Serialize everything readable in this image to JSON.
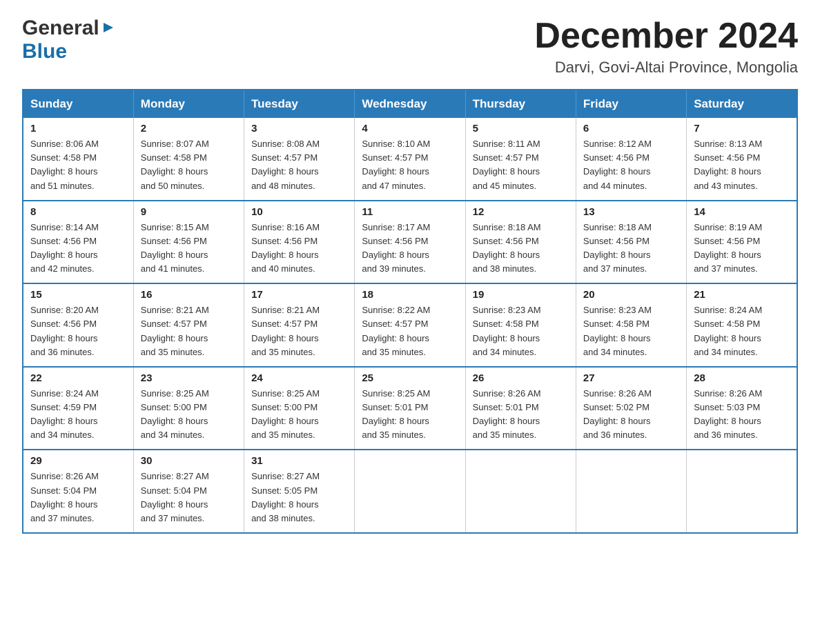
{
  "header": {
    "logo_general": "General",
    "logo_blue": "Blue",
    "month_title": "December 2024",
    "location": "Darvi, Govi-Altai Province, Mongolia"
  },
  "days_of_week": [
    "Sunday",
    "Monday",
    "Tuesday",
    "Wednesday",
    "Thursday",
    "Friday",
    "Saturday"
  ],
  "weeks": [
    [
      {
        "day": "1",
        "sunrise": "8:06 AM",
        "sunset": "4:58 PM",
        "daylight": "8 hours and 51 minutes."
      },
      {
        "day": "2",
        "sunrise": "8:07 AM",
        "sunset": "4:58 PM",
        "daylight": "8 hours and 50 minutes."
      },
      {
        "day": "3",
        "sunrise": "8:08 AM",
        "sunset": "4:57 PM",
        "daylight": "8 hours and 48 minutes."
      },
      {
        "day": "4",
        "sunrise": "8:10 AM",
        "sunset": "4:57 PM",
        "daylight": "8 hours and 47 minutes."
      },
      {
        "day": "5",
        "sunrise": "8:11 AM",
        "sunset": "4:57 PM",
        "daylight": "8 hours and 45 minutes."
      },
      {
        "day": "6",
        "sunrise": "8:12 AM",
        "sunset": "4:56 PM",
        "daylight": "8 hours and 44 minutes."
      },
      {
        "day": "7",
        "sunrise": "8:13 AM",
        "sunset": "4:56 PM",
        "daylight": "8 hours and 43 minutes."
      }
    ],
    [
      {
        "day": "8",
        "sunrise": "8:14 AM",
        "sunset": "4:56 PM",
        "daylight": "8 hours and 42 minutes."
      },
      {
        "day": "9",
        "sunrise": "8:15 AM",
        "sunset": "4:56 PM",
        "daylight": "8 hours and 41 minutes."
      },
      {
        "day": "10",
        "sunrise": "8:16 AM",
        "sunset": "4:56 PM",
        "daylight": "8 hours and 40 minutes."
      },
      {
        "day": "11",
        "sunrise": "8:17 AM",
        "sunset": "4:56 PM",
        "daylight": "8 hours and 39 minutes."
      },
      {
        "day": "12",
        "sunrise": "8:18 AM",
        "sunset": "4:56 PM",
        "daylight": "8 hours and 38 minutes."
      },
      {
        "day": "13",
        "sunrise": "8:18 AM",
        "sunset": "4:56 PM",
        "daylight": "8 hours and 37 minutes."
      },
      {
        "day": "14",
        "sunrise": "8:19 AM",
        "sunset": "4:56 PM",
        "daylight": "8 hours and 37 minutes."
      }
    ],
    [
      {
        "day": "15",
        "sunrise": "8:20 AM",
        "sunset": "4:56 PM",
        "daylight": "8 hours and 36 minutes."
      },
      {
        "day": "16",
        "sunrise": "8:21 AM",
        "sunset": "4:57 PM",
        "daylight": "8 hours and 35 minutes."
      },
      {
        "day": "17",
        "sunrise": "8:21 AM",
        "sunset": "4:57 PM",
        "daylight": "8 hours and 35 minutes."
      },
      {
        "day": "18",
        "sunrise": "8:22 AM",
        "sunset": "4:57 PM",
        "daylight": "8 hours and 35 minutes."
      },
      {
        "day": "19",
        "sunrise": "8:23 AM",
        "sunset": "4:58 PM",
        "daylight": "8 hours and 34 minutes."
      },
      {
        "day": "20",
        "sunrise": "8:23 AM",
        "sunset": "4:58 PM",
        "daylight": "8 hours and 34 minutes."
      },
      {
        "day": "21",
        "sunrise": "8:24 AM",
        "sunset": "4:58 PM",
        "daylight": "8 hours and 34 minutes."
      }
    ],
    [
      {
        "day": "22",
        "sunrise": "8:24 AM",
        "sunset": "4:59 PM",
        "daylight": "8 hours and 34 minutes."
      },
      {
        "day": "23",
        "sunrise": "8:25 AM",
        "sunset": "5:00 PM",
        "daylight": "8 hours and 34 minutes."
      },
      {
        "day": "24",
        "sunrise": "8:25 AM",
        "sunset": "5:00 PM",
        "daylight": "8 hours and 35 minutes."
      },
      {
        "day": "25",
        "sunrise": "8:25 AM",
        "sunset": "5:01 PM",
        "daylight": "8 hours and 35 minutes."
      },
      {
        "day": "26",
        "sunrise": "8:26 AM",
        "sunset": "5:01 PM",
        "daylight": "8 hours and 35 minutes."
      },
      {
        "day": "27",
        "sunrise": "8:26 AM",
        "sunset": "5:02 PM",
        "daylight": "8 hours and 36 minutes."
      },
      {
        "day": "28",
        "sunrise": "8:26 AM",
        "sunset": "5:03 PM",
        "daylight": "8 hours and 36 minutes."
      }
    ],
    [
      {
        "day": "29",
        "sunrise": "8:26 AM",
        "sunset": "5:04 PM",
        "daylight": "8 hours and 37 minutes."
      },
      {
        "day": "30",
        "sunrise": "8:27 AM",
        "sunset": "5:04 PM",
        "daylight": "8 hours and 37 minutes."
      },
      {
        "day": "31",
        "sunrise": "8:27 AM",
        "sunset": "5:05 PM",
        "daylight": "8 hours and 38 minutes."
      },
      null,
      null,
      null,
      null
    ]
  ],
  "labels": {
    "sunrise": "Sunrise:",
    "sunset": "Sunset:",
    "daylight": "Daylight:"
  }
}
